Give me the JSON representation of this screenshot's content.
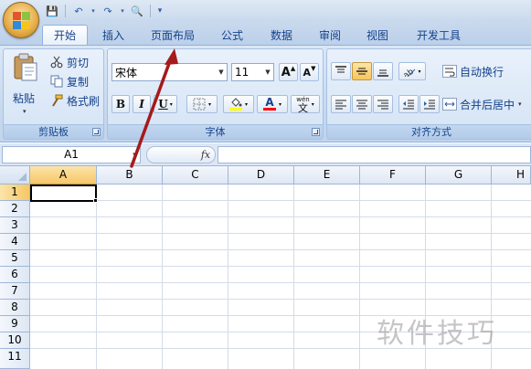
{
  "quick_access": {
    "save": "💾",
    "undo": "↶",
    "redo": "↷",
    "print_preview": "🔍",
    "customize": "▾"
  },
  "tabs": [
    {
      "label": "开始",
      "active": true
    },
    {
      "label": "插入"
    },
    {
      "label": "页面布局"
    },
    {
      "label": "公式"
    },
    {
      "label": "数据"
    },
    {
      "label": "审阅"
    },
    {
      "label": "视图"
    },
    {
      "label": "开发工具"
    }
  ],
  "clipboard": {
    "paste_label": "粘贴",
    "cut_label": "剪切",
    "copy_label": "复制",
    "format_painter_label": "格式刷",
    "group_label": "剪贴板"
  },
  "font": {
    "font_name": "宋体",
    "font_size": "11",
    "grow_label": "A",
    "shrink_label": "A",
    "bold": "B",
    "italic": "I",
    "underline": "U",
    "font_color_letter": "A",
    "phonetic_label": "wén",
    "phonetic_char": "文",
    "group_label": "字体",
    "fill_color": "#ffff00",
    "font_color": "#ff0000"
  },
  "alignment": {
    "wrap_text_label": "自动换行",
    "merge_center_label": "合并后居中",
    "group_label": "对齐方式"
  },
  "formula_bar": {
    "name_box": "A1",
    "fx_label": "fx",
    "formula": ""
  },
  "columns": [
    "A",
    "B",
    "C",
    "D",
    "E",
    "F",
    "G",
    "H"
  ],
  "rows": [
    "1",
    "2",
    "3",
    "4",
    "5",
    "6",
    "7",
    "8",
    "9",
    "10",
    "11"
  ],
  "watermark": "软件技巧",
  "colors": {
    "accent": "#15428b",
    "selection": "#f6c767",
    "annotation_arrow": "#a51a1a"
  }
}
